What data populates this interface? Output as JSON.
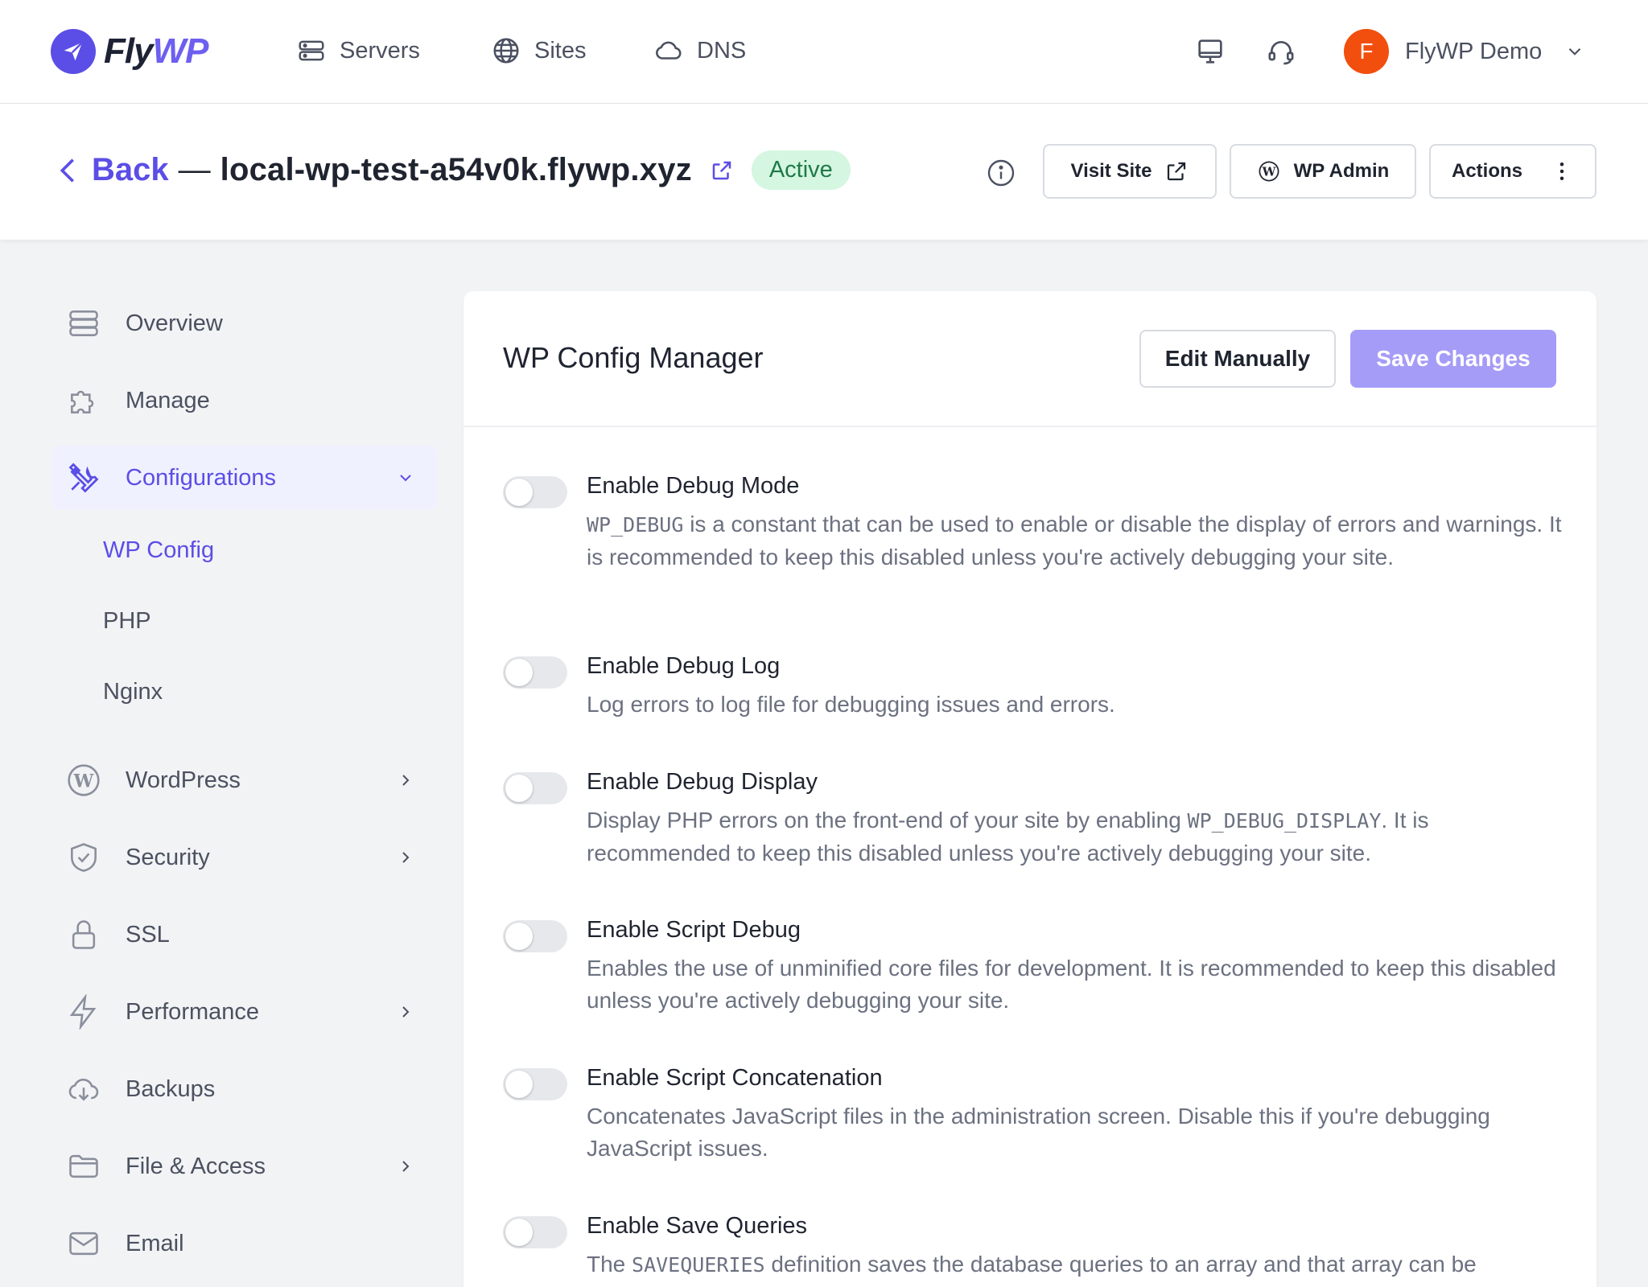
{
  "brand": {
    "name_part1": "Fly",
    "name_part2": "WP",
    "accent": "#5b4ee6"
  },
  "topnav": {
    "items": [
      {
        "label": "Servers",
        "icon": "server-icon"
      },
      {
        "label": "Sites",
        "icon": "globe-icon"
      },
      {
        "label": "DNS",
        "icon": "cloud-icon"
      }
    ],
    "icons": [
      "monitor-icon",
      "headset-icon"
    ],
    "user": {
      "initial": "F",
      "name": "FlyWP Demo",
      "avatar_color": "#f24e0d"
    }
  },
  "header": {
    "back_label": "Back",
    "separator": "—",
    "site_title": "local-wp-test-a54v0k.flywp.xyz",
    "status": "Active",
    "status_color": "#1f7a48",
    "buttons": {
      "visit": "Visit Site",
      "wp_admin": "WP Admin",
      "actions": "Actions"
    }
  },
  "sidebar": {
    "items": [
      {
        "label": "Overview",
        "icon": "server-stack-icon"
      },
      {
        "label": "Manage",
        "icon": "puzzle-icon"
      },
      {
        "label": "Configurations",
        "icon": "tools-icon",
        "active": true,
        "expanded": true
      },
      {
        "label": "WordPress",
        "icon": "wordpress-icon"
      },
      {
        "label": "Security",
        "icon": "shield-check-icon"
      },
      {
        "label": "SSL",
        "icon": "lock-icon"
      },
      {
        "label": "Performance",
        "icon": "bolt-icon"
      },
      {
        "label": "Backups",
        "icon": "cloud-download-icon"
      },
      {
        "label": "File & Access",
        "icon": "folder-icon"
      },
      {
        "label": "Email",
        "icon": "mail-icon"
      }
    ],
    "sub_items": [
      {
        "label": "WP Config",
        "active": true
      },
      {
        "label": "PHP"
      },
      {
        "label": "Nginx"
      }
    ]
  },
  "main": {
    "title": "WP Config Manager",
    "edit_button": "Edit Manually",
    "save_button": "Save Changes",
    "settings": [
      {
        "title": "Enable Debug Mode",
        "enabled": false,
        "desc_code_start": "WP_DEBUG",
        "desc_text": " is a constant that can be used to enable or disable the display of errors and warnings. It is recommended to keep this disabled unless you're actively debugging your site."
      },
      {
        "title": "Enable Debug Log",
        "enabled": false,
        "desc_text": "Log errors to log file for debugging issues and errors."
      },
      {
        "title": "Enable Debug Display",
        "enabled": false,
        "desc_text_before": "Display PHP errors on the front-end of your site by enabling ",
        "desc_code": "WP_DEBUG_DISPLAY",
        "desc_text_after": ". It is recommended to keep this disabled unless you're actively debugging your site."
      },
      {
        "title": "Enable Script Debug",
        "enabled": false,
        "desc_text": "Enables the use of unminified core files for development. It is recommended to keep this disabled unless you're actively debugging your site."
      },
      {
        "title": "Enable Script Concatenation",
        "enabled": false,
        "desc_text": "Concatenates JavaScript files in the administration screen. Disable this if you're debugging JavaScript issues."
      },
      {
        "title": "Enable Save Queries",
        "enabled": false,
        "desc_text_before": "The ",
        "desc_code": "SAVEQUERIES",
        "desc_text_after": " definition saves the database queries to an array and that array can be"
      }
    ]
  }
}
